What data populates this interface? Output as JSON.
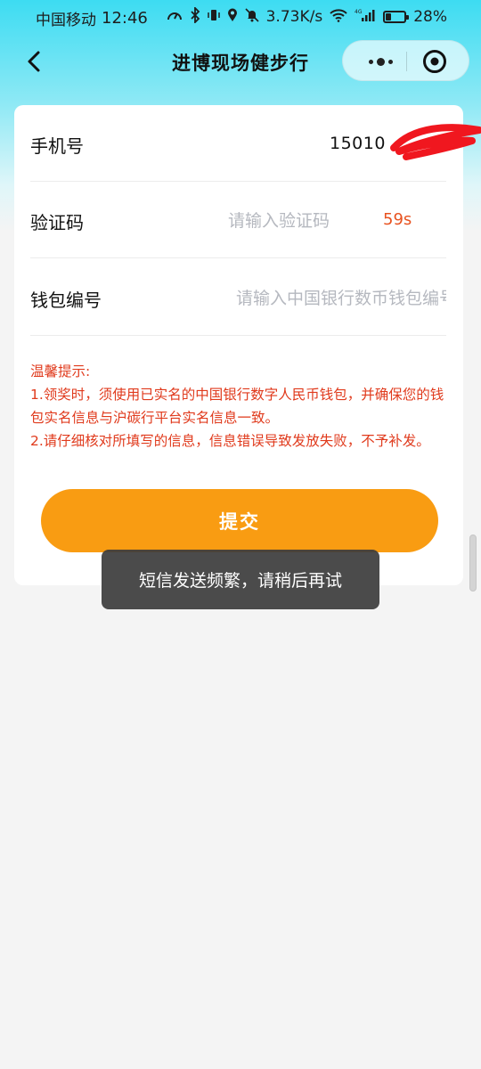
{
  "status_bar": {
    "carrier": "中国移动",
    "time": "12:46",
    "net_speed": "3.73K/s",
    "battery": "28%",
    "battery_level": 0.28
  },
  "nav": {
    "title": "进博现场健步行"
  },
  "form": {
    "phone": {
      "label": "手机号",
      "value": "15010"
    },
    "code": {
      "label": "验证码",
      "placeholder": "请输入验证码",
      "countdown": "59s"
    },
    "wallet": {
      "label": "钱包编号",
      "placeholder": "请输入中国银行数币钱包编号"
    }
  },
  "notice": {
    "title": "温馨提示:",
    "lines": [
      "1.领奖时，须使用已实名的中国银行数字人民币钱包，并确保您的钱包实名信息与沪碳行平台实名信息一致。",
      "2.请仔细核对所填写的信息，信息错误导致发放失败，不予补发。"
    ]
  },
  "submit_label": "提交",
  "toast": "短信发送频繁，请稍后再试",
  "colors": {
    "accent": "#f99c12",
    "notice": "#e03a1c",
    "countdown": "#e8521f",
    "header": "#3ddcf2"
  }
}
